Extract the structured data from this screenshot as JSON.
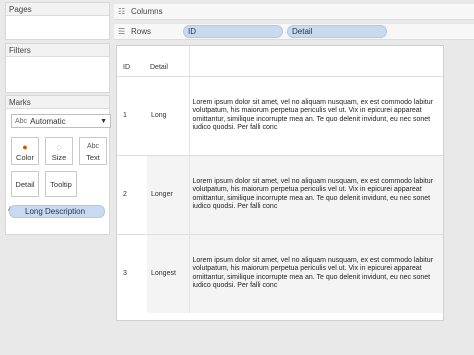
{
  "panels": {
    "pages": "Pages",
    "filters": "Filters",
    "marks": "Marks"
  },
  "marks": {
    "type_icon": "Abc",
    "type_value": "Automatic",
    "buttons": [
      "Color",
      "Size",
      "Text",
      "Detail",
      "Tooltip"
    ],
    "field_icon": "Abc",
    "field": "Long Description"
  },
  "shelves": {
    "columns": "Columns",
    "rows": "Rows",
    "row_pills": [
      "ID",
      "Detail"
    ]
  },
  "table": {
    "headers": [
      "ID",
      "Detail"
    ],
    "rows": [
      {
        "id": "1",
        "detail": "Long",
        "text": "Lorem ipsum dolor sit amet, vel no aliquam nusquam, ex est commodo labitur volutpatum, his maiorum perpetua periculis vel ut. Vix in epicurei appareat omittantur, similique incorrupte mea an. Te quo delenit invidunt, eu nec sonet iudico quodsi. Per falli conc"
      },
      {
        "id": "2",
        "detail": "Longer",
        "text": "Lorem ipsum dolor sit amet, vel no aliquam nusquam, ex est commodo labitur volutpatum, his maiorum perpetua periculis vel ut. Vix in epicurei appareat omittantur, similique incorrupte mea an. Te quo delenit invidunt, eu nec sonet iudico quodsi. Per falli conc"
      },
      {
        "id": "3",
        "detail": "Longest",
        "text": "Lorem ipsum dolor sit amet, vel no aliquam nusquam, ex est commodo labitur volutpatum, his maiorum perpetua periculis vel ut. Vix in epicurei appareat omittantur, similique incorrupte mea an. Te quo delenit invidunt, eu nec sonet iudico quodsi. Per falli conc"
      }
    ]
  }
}
